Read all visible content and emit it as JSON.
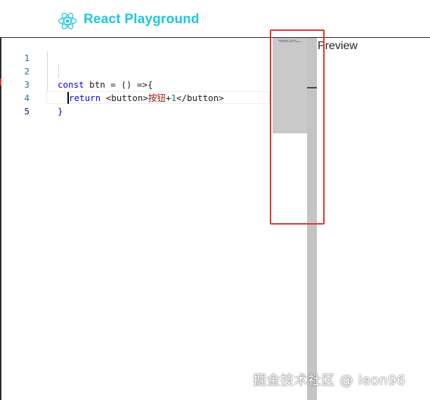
{
  "header": {
    "title": "React Playground",
    "logo_icon": "react-atom-icon",
    "accent_color": "#1ec6e0"
  },
  "editor": {
    "line_numbers": [
      "1",
      "2",
      "3",
      "4",
      "5"
    ],
    "lines": {
      "l2": {
        "kw": "const",
        "rest": " btn = () =>{"
      },
      "l3": {
        "kw": "return",
        "open": " <button>",
        "cn": "按钮",
        "plus": "+",
        "num": "1",
        "close": "</button>"
      },
      "l4": {
        "brace": "}"
      }
    }
  },
  "preview": {
    "label": "Preview"
  },
  "watermark": {
    "text": "掘金技术社区 @ leon96"
  }
}
